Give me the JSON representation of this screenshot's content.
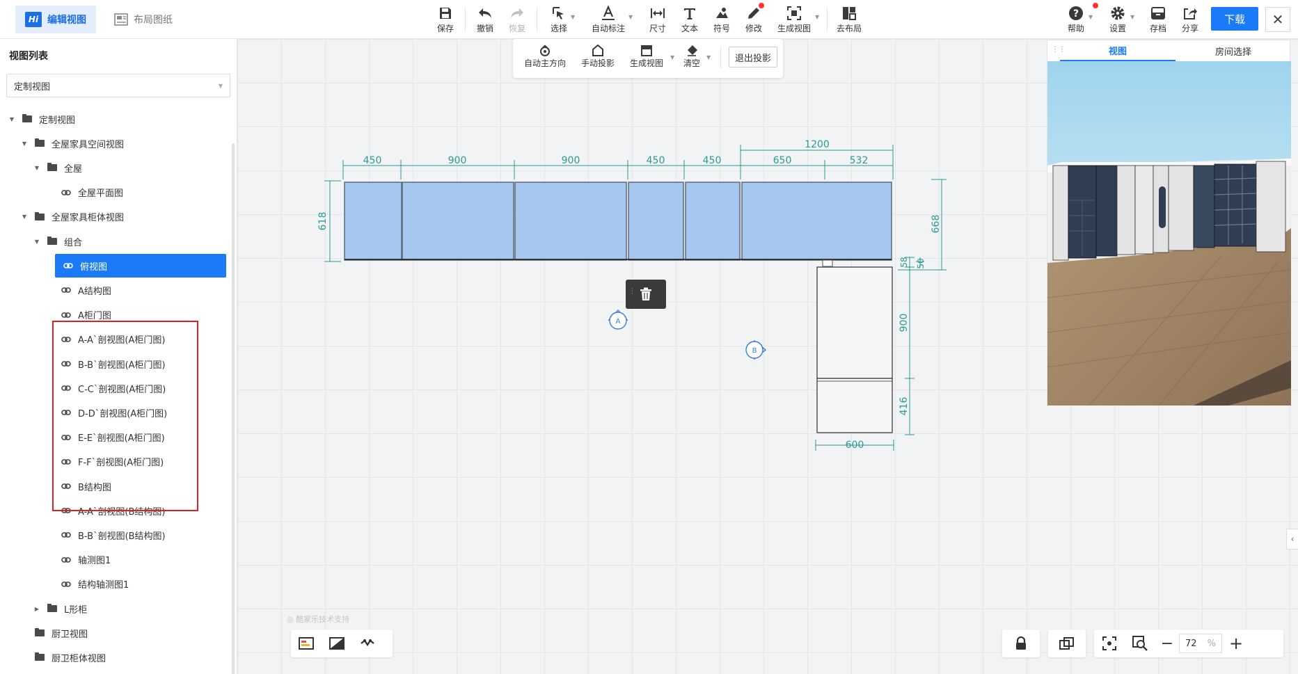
{
  "topbar": {
    "mode_tabs": [
      {
        "label": "编辑视图",
        "logo": "Hi",
        "active": true
      },
      {
        "label": "布局图纸",
        "active": false
      }
    ],
    "tools": [
      {
        "label": "保存",
        "icon": "save-icon"
      },
      {
        "label": "撤销",
        "icon": "undo-icon"
      },
      {
        "label": "恢复",
        "icon": "redo-icon",
        "disabled": true
      },
      {
        "label": "选择",
        "icon": "select-icon",
        "dropdown": true
      },
      {
        "label": "自动标注",
        "icon": "auto-annotate-icon",
        "dropdown": true
      },
      {
        "label": "尺寸",
        "icon": "dimension-icon"
      },
      {
        "label": "文本",
        "icon": "text-icon"
      },
      {
        "label": "符号",
        "icon": "symbol-icon"
      },
      {
        "label": "修改",
        "icon": "edit-pen-icon"
      },
      {
        "label": "生成视图",
        "icon": "generate-view-icon",
        "dropdown": true
      },
      {
        "label": "去布局",
        "icon": "layout-icon"
      }
    ],
    "right_tools": [
      {
        "label": "帮助",
        "icon": "help-icon"
      },
      {
        "label": "设置",
        "icon": "gear-icon"
      },
      {
        "label": "存档",
        "icon": "archive-icon"
      },
      {
        "label": "分享",
        "icon": "share-icon"
      }
    ],
    "download_label": "下载",
    "close_glyph": "✕"
  },
  "left_panel": {
    "title": "视图列表",
    "select_value": "定制视图",
    "tree": [
      {
        "label": "定制视图",
        "type": "folder",
        "expanded": true
      },
      {
        "label": "全屋家具空间视图",
        "type": "folder",
        "expanded": true
      },
      {
        "label": "全屋",
        "type": "folder",
        "expanded": true
      },
      {
        "label": "全屋平面图",
        "type": "link"
      },
      {
        "label": "全屋家具柜体视图",
        "type": "folder",
        "expanded": true
      },
      {
        "label": "组合",
        "type": "folder",
        "expanded": true
      },
      {
        "label": "俯视图",
        "type": "link",
        "selected": true
      },
      {
        "label": "A结构图",
        "type": "link"
      },
      {
        "label": "A柜门图",
        "type": "link"
      },
      {
        "label": "A-A`剖视图(A柜门图)",
        "type": "link"
      },
      {
        "label": "B-B`剖视图(A柜门图)",
        "type": "link"
      },
      {
        "label": "C-C`剖视图(A柜门图)",
        "type": "link"
      },
      {
        "label": "D-D`剖视图(A柜门图)",
        "type": "link"
      },
      {
        "label": "E-E`剖视图(A柜门图)",
        "type": "link"
      },
      {
        "label": "F-F`剖视图(A柜门图)",
        "type": "link"
      },
      {
        "label": "B结构图",
        "type": "link"
      },
      {
        "label": "A-A`剖视图(B结构图)",
        "type": "link"
      },
      {
        "label": "B-B`剖视图(B结构图)",
        "type": "link"
      },
      {
        "label": "轴测图1",
        "type": "link"
      },
      {
        "label": "结构轴测图1",
        "type": "link"
      },
      {
        "label": "L形柜",
        "type": "folder",
        "expanded": false
      },
      {
        "label": "厨卫视图",
        "type": "folder"
      },
      {
        "label": "厨卫柜体视图",
        "type": "folder"
      }
    ]
  },
  "projection_bar": {
    "tools": [
      {
        "label": "自动主方向",
        "icon": "auto-direction-icon"
      },
      {
        "label": "手动投影",
        "icon": "manual-projection-icon"
      },
      {
        "label": "生成视图",
        "icon": "generate-view-icon",
        "dropdown": true
      },
      {
        "label": "清空",
        "icon": "eraser-icon",
        "dropdown": true
      }
    ],
    "exit_label": "退出投影"
  },
  "preview": {
    "tabs": [
      {
        "label": "视图",
        "active": true
      },
      {
        "label": "房间选择",
        "active": false
      }
    ]
  },
  "drawing": {
    "dims_top": [
      "450",
      "900",
      "900",
      "450",
      "450",
      "650",
      "532"
    ],
    "dim_overall": "1200",
    "dim_left": "618",
    "dim_right": "668",
    "dim_small_a": "58",
    "dim_small_b": "50",
    "dim_mid_v": "900",
    "dim_low_v": "416",
    "dim_bottom": "600",
    "marker_a": "A",
    "marker_b": "B"
  },
  "watermark": "酷家乐技术支持",
  "zoom": {
    "value": "72",
    "unit": "%",
    "minus": "−",
    "plus": "+"
  },
  "colors": {
    "accent": "#1a7af8",
    "cabinet_fill": "#a6c8f0",
    "dimension": "#2a9a92",
    "highlight_box": "#e02020"
  }
}
